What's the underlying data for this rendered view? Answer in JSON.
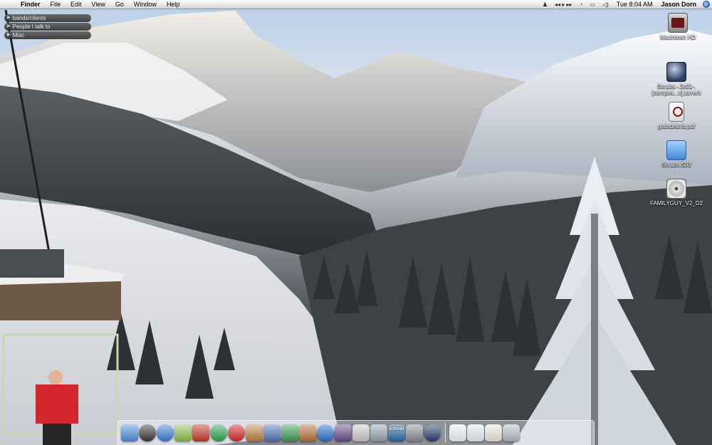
{
  "menubar": {
    "apple_glyph": "",
    "app_name": "Finder",
    "menus": [
      "File",
      "Edit",
      "View",
      "Go",
      "Window",
      "Help"
    ],
    "clock": "Tue 8:04 AM",
    "user": "Jason Dorn",
    "extras": [
      "♟",
      "◂◂ ▸ ▸▸",
      "◔",
      "▭",
      "◁)"
    ]
  },
  "stickies": [
    "bands/clients",
    "People I talk to",
    "Misc"
  ],
  "desktop_icons": [
    {
      "label": "Macintosh HD",
      "icon": "hard-drive-icon"
    },
    {
      "label": "Scrubs.-.3x01-.\n[complet...n].torrent",
      "icon": "torrent-file-icon"
    },
    {
      "label": "godsdebris.pdf",
      "icon": "pdf-file-icon"
    },
    {
      "label": "Scrubs.S03",
      "icon": "folder-icon"
    },
    {
      "label": "FAMILYGUY_V2_D2",
      "icon": "dvd-icon"
    }
  ],
  "dock": {
    "apps": [
      {
        "name": "finder-icon",
        "color": "#4e8fe0"
      },
      {
        "name": "dashboard-icon",
        "color": "#3b3b3b"
      },
      {
        "name": "safari-icon",
        "color": "#3d7fd6"
      },
      {
        "name": "adium-icon",
        "color": "#8fc24a"
      },
      {
        "name": "transmission-icon",
        "color": "#c73a2b"
      },
      {
        "name": "itunes-icon",
        "color": "#2fa84f"
      },
      {
        "name": "quicktime-icon",
        "color": "#d7262c"
      },
      {
        "name": "photoshop-icon",
        "color": "#c2843e"
      },
      {
        "name": "preview-icon",
        "color": "#5577bb"
      },
      {
        "name": "garageband-icon",
        "color": "#3c9e5a"
      },
      {
        "name": "guitar-icon",
        "color": "#b8733a"
      },
      {
        "name": "quicktime-player-icon",
        "color": "#2b72d0"
      },
      {
        "name": "photo-booth-icon",
        "color": "#6a4c8a"
      },
      {
        "name": "ipod-icon",
        "color": "#cccccc"
      },
      {
        "name": "apple-icon",
        "color": "#9aa4b3"
      },
      {
        "name": "ertrinkt-icon",
        "color": "#2a6ea3",
        "label": "ertrinkt"
      },
      {
        "name": "camera-icon",
        "color": "#8a8f96"
      },
      {
        "name": "net-icon",
        "color": "#2a3e70"
      }
    ],
    "docs": [
      {
        "name": "document-icon",
        "color": "#e9eef4"
      },
      {
        "name": "document-icon",
        "color": "#dfe7ef"
      },
      {
        "name": "document-icon",
        "color": "#e6e2d8"
      },
      {
        "name": "trash-icon",
        "color": "#aeb4ba"
      }
    ]
  }
}
